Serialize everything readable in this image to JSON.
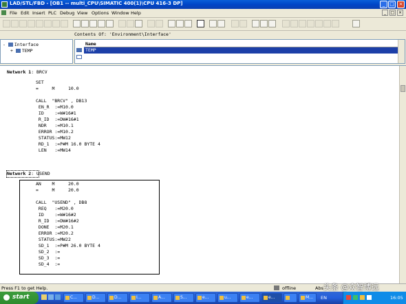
{
  "window": {
    "title": "LAD/STL/FBD  - [OB1 -- multi_CPU\\SIMATIC 400(1)\\CPU 416-3 DP]",
    "controls": {
      "minimize": "_",
      "maximize": "□",
      "close": "×"
    }
  },
  "menubar": {
    "items": [
      "File",
      "Edit",
      "Insert",
      "PLC",
      "Debug",
      "View",
      "Options",
      "Window",
      "Help"
    ],
    "mdi_controls": {
      "minimize": "_",
      "restore": "□",
      "close": "×"
    }
  },
  "toolbar": {
    "buttons": [
      "new",
      "open",
      "online",
      "save",
      "print",
      "cut",
      "copy",
      "paste",
      "undo",
      "redo",
      "load",
      "monitor",
      "network",
      "zoom",
      "overview",
      "details",
      "help"
    ]
  },
  "interface": {
    "header": "Contents Of: 'Environment\\Interface'",
    "tree": [
      {
        "label": "Interface",
        "expander": "-"
      },
      {
        "label": "TEMP",
        "expander": "+"
      }
    ],
    "column_name": "Name",
    "rows": [
      "TEMP"
    ]
  },
  "networks": [
    {
      "number_label": "Network 1",
      "title": ": BRCV",
      "lines": [
        "SET",
        "=     M     10.0",
        "",
        "CALL  \"BRCV\" , DB13",
        " EN_R  :=M10.0",
        " ID    :=W#16#1",
        " R_ID  :=DW#16#1",
        " NDR   :=M10.1",
        " ERROR :=M10.2",
        " STATUS:=MW12",
        " RD_1  :=P#M 16.0 BYTE 4",
        " LEN   :=MW14"
      ]
    },
    {
      "number_label": "Network 2",
      "title": ": USEND",
      "lines": [
        "AN    M     20.0",
        "=     M     20.0",
        "",
        "CALL  \"USEND\" , DB8",
        " REQ   :=M20.0",
        " ID    :=W#16#2",
        " R_ID  :=DW#16#2",
        " DONE  :=M20.1",
        " ERROR :=M20.2",
        " STATUS:=MW22",
        " SD_1  :=P#M 26.0 BYTE 4",
        " SD_2  :=",
        " SD_3  :=",
        " SD_4  :="
      ]
    }
  ],
  "statusbar": {
    "hint": "Press F1 to get Help.",
    "mode": "offline",
    "abs": "Abs"
  },
  "taskbar": {
    "start": "start",
    "tasks": [
      "C...",
      "D...",
      "D...",
      "I...",
      "A...",
      "S...",
      "e...",
      "u...",
      "e...",
      "e...",
      "",
      "M..."
    ],
    "lang": "EN",
    "clock": "16:05"
  },
  "watermark": "头条 @众智博远",
  "colors": {
    "title_bar": "#0a5fd8",
    "selected_row": "#1c3fa8",
    "taskbar": "#245edb",
    "start_button": "#2e8b2e"
  }
}
